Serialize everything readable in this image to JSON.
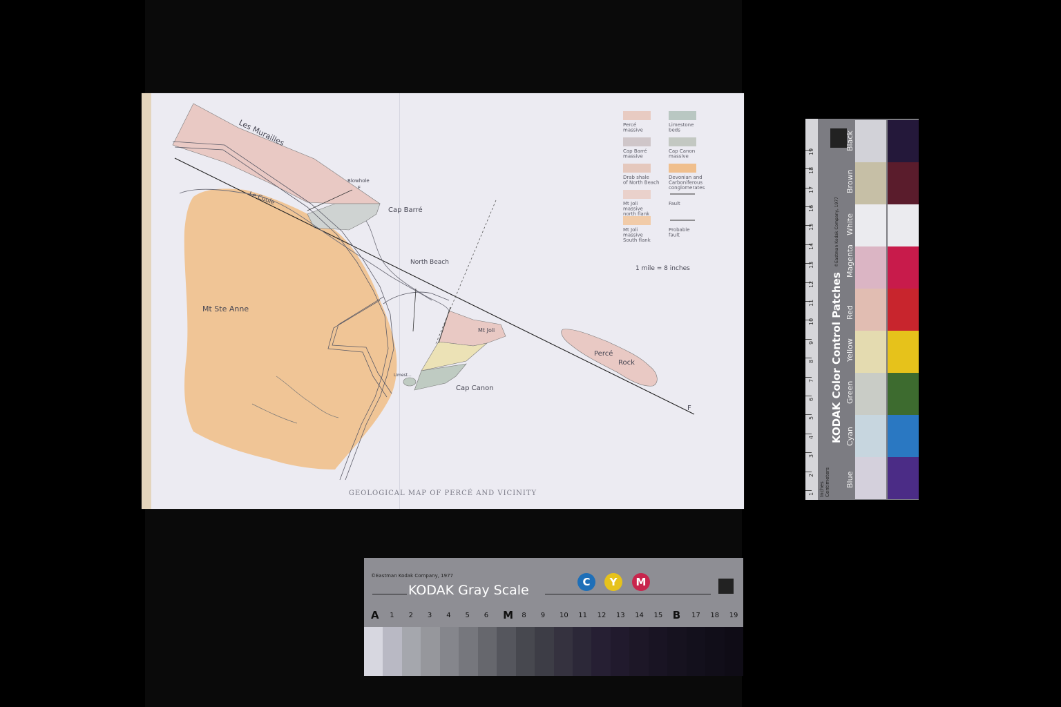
{
  "map": {
    "title": "GEOLOGICAL MAP OF PERCÉ AND VICINITY",
    "labels": {
      "les_murailles": "Les Murailles",
      "le_coule": "Le Coule",
      "blowhole": "Blowhole",
      "cap_barre": "Cap Barré",
      "north_beach": "North Beach",
      "mt_ste_anne": "Mt Ste Anne",
      "mt_joli": "Mt Joli",
      "perce_rock": [
        "Percé",
        "Rock"
      ],
      "limestone": "Limest...",
      "cap_canon": "Cap Canon",
      "fault_marker": "F"
    },
    "legend": [
      {
        "color": "#e8cbc2",
        "lines": [
          "Percé",
          "massive"
        ]
      },
      {
        "color": "#b9c7c2",
        "lines": [
          "Limestone",
          "beds"
        ]
      },
      {
        "color": "#cfc6c9",
        "lines": [
          "Cap Barré",
          "massive"
        ]
      },
      {
        "color": "#c3c8c2",
        "lines": [
          "Cap Canon",
          "massive"
        ]
      },
      {
        "color": "#e5c8bd",
        "lines": [
          "Drab shale",
          "of North Beach"
        ]
      },
      {
        "color": "#f0bf8d",
        "lines": [
          "Devonian and",
          "Carboniferous",
          "conglomerates"
        ]
      },
      {
        "color": "#ead1cb",
        "lines": [
          "Mt Joli",
          "massive",
          "north flank"
        ]
      },
      {
        "symbol": "fault",
        "lines": [
          "Fault"
        ]
      },
      {
        "color": "#f1cba8",
        "lines": [
          "Mt Joli",
          "massive",
          "South flank"
        ]
      },
      {
        "symbol": "probable-fault",
        "lines": [
          "Probable",
          "fault"
        ]
      }
    ],
    "scale": "1 mile = 8 inches",
    "colors": {
      "conglomerate": "#f0c596",
      "perce_massive": "#e9c9c4",
      "cap_barre": "#cfd3d2",
      "cap_canon": "#bfcbc2",
      "yellow_band": "#ece2b6",
      "paper": "#ecebf2"
    }
  },
  "color_card": {
    "title": "KODAK Color Control Patches",
    "copyright": "©Eastman Kodak Company, 1977",
    "ruler_units": [
      "Inches",
      "Centimeters"
    ],
    "ruler_numbers": [
      "1",
      "2",
      "3",
      "4",
      "5",
      "6",
      "7",
      "8",
      "9",
      "10",
      "11",
      "12",
      "13",
      "14",
      "15",
      "16",
      "17",
      "18",
      "19"
    ],
    "patches": [
      {
        "name": "Blue",
        "light": "#d4d0dc",
        "dark": "#4b2c86"
      },
      {
        "name": "Cyan",
        "light": "#c7d6df",
        "dark": "#2a78c2"
      },
      {
        "name": "Green",
        "light": "#c9ccc6",
        "dark": "#3d6b2f"
      },
      {
        "name": "Yellow",
        "light": "#e4dbb0",
        "dark": "#e6c21b"
      },
      {
        "name": "Red",
        "light": "#e1bdb2",
        "dark": "#c8252d"
      },
      {
        "name": "Magenta",
        "light": "#dbb5c4",
        "dark": "#c81b4b"
      },
      {
        "name": "White",
        "light": "#ebebef",
        "dark": "#ebebef"
      },
      {
        "name": "Brown",
        "light": "#c6bfa6",
        "dark": "#5a1c2c"
      },
      {
        "name": "Black",
        "light": "#d2d2d8",
        "dark": "#24183a"
      }
    ]
  },
  "gray_card": {
    "copyright": "©Eastman Kodak Company, 1977",
    "title": "KODAK Gray Scale",
    "dots": [
      {
        "letter": "C",
        "color": "#1e6fb8"
      },
      {
        "letter": "Y",
        "color": "#e6c21b"
      },
      {
        "letter": "M",
        "color": "#c8264d"
      }
    ],
    "steps": [
      "A",
      "1",
      "2",
      "3",
      "4",
      "5",
      "6",
      "M",
      "8",
      "9",
      "10",
      "11",
      "12",
      "13",
      "14",
      "15",
      "B",
      "17",
      "18",
      "19"
    ],
    "step_colors": [
      "#d7d7e0",
      "#b9b9c4",
      "#a5a7ad",
      "#96979c",
      "#85868c",
      "#76777d",
      "#66676d",
      "#55565d",
      "#47484f",
      "#3d3d46",
      "#35323f",
      "#2c2838",
      "#261f33",
      "#211a2d",
      "#1d1727",
      "#191423",
      "#16121f",
      "#13101c",
      "#110e19",
      "#0f0c16"
    ]
  }
}
